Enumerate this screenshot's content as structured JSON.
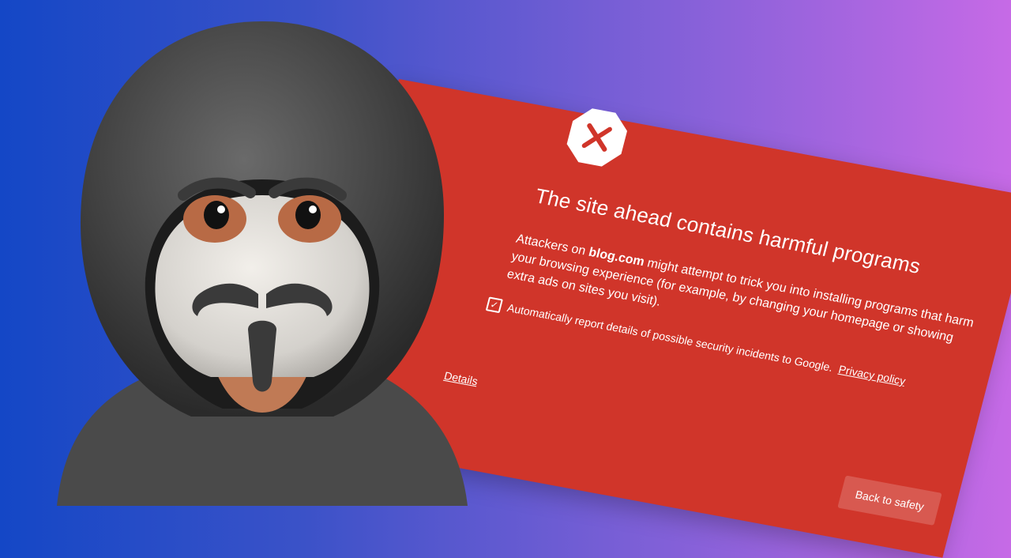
{
  "warning": {
    "title": "The site ahead contains harmful programs",
    "body_prefix": "Attackers on",
    "body_site": "blog.com",
    "body_suffix": "might attempt to trick you into installing programs that harm your browsing experience (for example, by changing your homepage or showing extra ads on sites you visit).",
    "report_label": "Automatically report details of possible security incidents to Google.",
    "report_checked": true,
    "privacy_link": "Privacy policy",
    "details_link": "Details",
    "back_button": "Back to safety"
  },
  "icons": {
    "warning": "error-x-octagon-icon",
    "checkbox": "checkmark-icon"
  },
  "colors": {
    "warning_background": "#d0352a",
    "background_gradient_start": "#1447c6",
    "background_gradient_end": "#c66ae6",
    "hood": "#3a3a3a",
    "mask": "#d9d6d1"
  }
}
